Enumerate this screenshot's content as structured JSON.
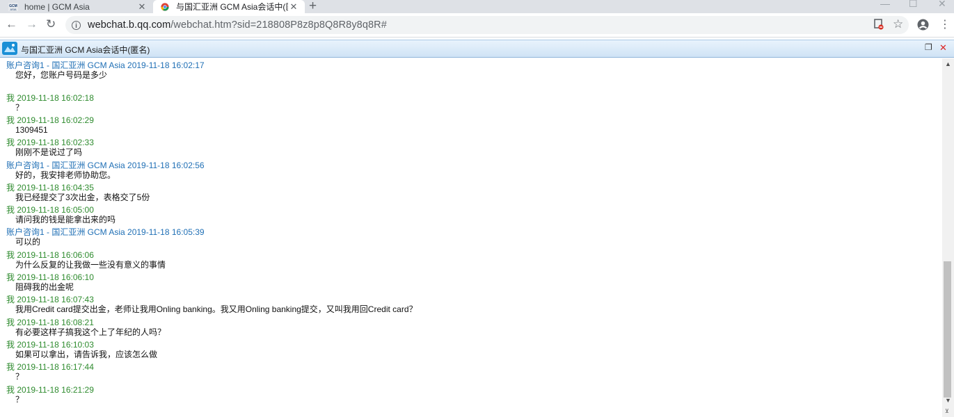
{
  "browser": {
    "tabs": [
      {
        "title": "home | GCM Asia",
        "favicon": "gcm-asia-logo",
        "active": false
      },
      {
        "title": "与国汇亚洲 GCM Asia会话中(匿",
        "favicon": "qq-chrome-logo",
        "active": true
      }
    ],
    "url_host": "webchat.b.qq.com",
    "url_path": "/webchat.htm?sid=218808P8z8p8Q8R8y8q8R#",
    "icons": [
      "back-icon",
      "forward-icon",
      "reload-icon",
      "info-icon",
      "blocked-popup-icon",
      "star-icon",
      "account-icon",
      "menu-icon"
    ]
  },
  "chat": {
    "title": "与国汇亚洲 GCM Asia会话中(匿名)",
    "colors": {
      "agent": "#1f6fb5",
      "me": "#2e8b2e"
    },
    "messages": [
      {
        "sender": "账户咨询1 - 国汇亚洲 GCM Asia",
        "time": "2019-11-18 16:02:17",
        "text": "您好，您账户号码是多少",
        "role": "agent"
      },
      {
        "sender": "我",
        "time": "2019-11-18 16:02:18",
        "text": "？",
        "role": "me"
      },
      {
        "sender": "我",
        "time": "2019-11-18 16:02:29",
        "text": "1309451",
        "role": "me"
      },
      {
        "sender": "我",
        "time": "2019-11-18 16:02:33",
        "text": "刚刚不是说过了吗",
        "role": "me"
      },
      {
        "sender": "账户咨询1 - 国汇亚洲 GCM Asia",
        "time": "2019-11-18 16:02:56",
        "text": "好的，我安排老师协助您。",
        "role": "agent"
      },
      {
        "sender": "我",
        "time": "2019-11-18 16:04:35",
        "text": "我已经提交了3次出金，表格交了5份",
        "role": "me"
      },
      {
        "sender": "我",
        "time": "2019-11-18 16:05:00",
        "text": "请问我的钱是能拿出来的吗",
        "role": "me"
      },
      {
        "sender": "账户咨询1 - 国汇亚洲 GCM Asia",
        "time": "2019-11-18 16:05:39",
        "text": "可以的",
        "role": "agent"
      },
      {
        "sender": "我",
        "time": "2019-11-18 16:06:06",
        "text": "为什么反复的让我做一些没有意义的事情",
        "role": "me"
      },
      {
        "sender": "我",
        "time": "2019-11-18 16:06:10",
        "text": "阻碍我的出金呢",
        "role": "me"
      },
      {
        "sender": "我",
        "time": "2019-11-18 16:07:43",
        "text": "我用Credit card提交出金，老师让我用Onling banking。我又用Onling banking提交，又叫我用回Credit card？",
        "role": "me"
      },
      {
        "sender": "我",
        "time": "2019-11-18 16:08:21",
        "text": "有必要这样子搞我这个上了年纪的人吗？",
        "role": "me"
      },
      {
        "sender": "我",
        "time": "2019-11-18 16:10:03",
        "text": "如果可以拿出，请告诉我，应该怎么做",
        "role": "me"
      },
      {
        "sender": "我",
        "time": "2019-11-18 16:17:44",
        "text": "？",
        "role": "me"
      },
      {
        "sender": "我",
        "time": "2019-11-18 16:21:29",
        "text": "？",
        "role": "me"
      }
    ]
  }
}
